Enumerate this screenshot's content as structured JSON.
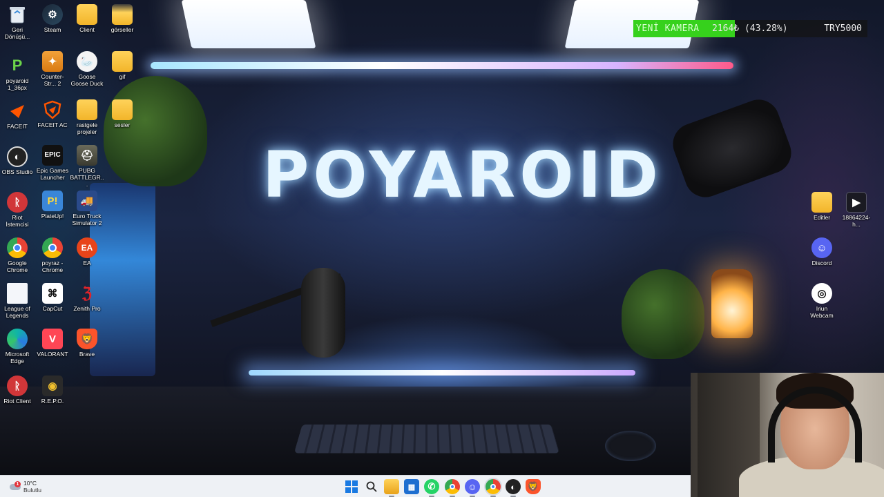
{
  "wallpaper": {
    "title": "POYAROID"
  },
  "donation_bar": {
    "label": "YENİ KAMERA",
    "amount": "2164₺ (43.28%)",
    "goal": "TRY5000",
    "progress_fraction": 0.4328,
    "fill_color": "#36d11c"
  },
  "desktop_icons": {
    "recycle_bin": "Geri Dönüşü...",
    "steam": "Steam",
    "client": "Client",
    "gorseller": "görseller",
    "poyaroid": "poyaroid 1_36px",
    "counter_strike": "Counter-Str... 2",
    "goose": "Goose Goose Duck",
    "gif": "gif",
    "faceit": "FACEIT",
    "faceit_ac": "FACEIT AC",
    "rastgele": "rastgele projeler",
    "sesler": "sesler",
    "obs": "OBS Studio",
    "epic": "Epic Games Launcher",
    "pubg": "PUBG BATTLEGR...",
    "riot_istemcisi": "Riot İstemcisi",
    "plateup": "PlateUp!",
    "euro_truck": "Euro Truck Simulator 2",
    "google_chrome": "Google Chrome",
    "poyraz_chrome": "poyraz - Chrome",
    "ea": "EA",
    "league": "League of Legends",
    "capcut": "CapCut",
    "zenith": "Zenith Pro",
    "edge": "Microsoft Edge",
    "valorant": "VALORANT",
    "brave": "Brave",
    "riot_client": "Riot Client",
    "repo": "R.E.P.O.",
    "editler": "Editler",
    "video_file": "18864224-h...",
    "discord": "Discord",
    "iriun": "Iriun Webcam"
  },
  "taskbar": {
    "weather_temp": "10°C",
    "weather_desc": "Bulutlu",
    "weather_badge": "1",
    "pinned": [
      "Start",
      "Search",
      "File Explorer",
      "Microsoft Store",
      "WhatsApp",
      "Chrome",
      "Discord",
      "Chrome (active)",
      "OBS",
      "Brave"
    ]
  }
}
